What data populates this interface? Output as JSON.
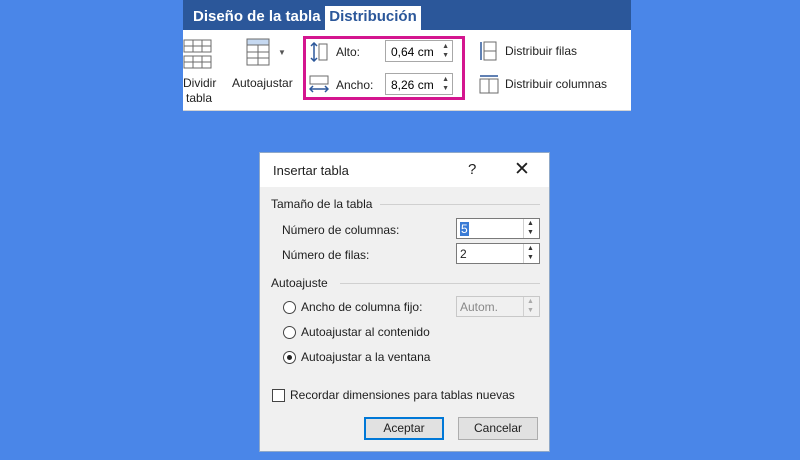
{
  "ribbon": {
    "tabs": [
      "Diseño de la tabla",
      "Distribución"
    ],
    "active_tab": "Distribución",
    "split_table": {
      "line1": "Dividir",
      "line2": "tabla"
    },
    "autofit": "Autoajustar",
    "height": {
      "label": "Alto:",
      "value": "0,64 cm"
    },
    "width": {
      "label": "Ancho:",
      "value": "8,26 cm"
    },
    "distribute_rows": "Distribuir filas",
    "distribute_columns": "Distribuir columnas",
    "highlight_color": "#d4158f"
  },
  "dialog": {
    "title": "Insertar tabla",
    "help": "?",
    "close": "✕",
    "size_group": "Tamaño de la tabla",
    "columns_label": "Número de columnas:",
    "columns_value": "5",
    "rows_label": "Número de filas:",
    "rows_value": "2",
    "autofit_group": "Autoajuste",
    "opt_fixed": "Ancho de columna fijo:",
    "fixed_value": "Autom.",
    "opt_content": "Autoajustar al contenido",
    "opt_window": "Autoajustar a la ventana",
    "selected_option": "Autoajustar a la ventana",
    "remember": "Recordar dimensiones para tablas nuevas",
    "remember_checked": false,
    "ok": "Aceptar",
    "cancel": "Cancelar"
  },
  "colors": {
    "background": "#4a86e8",
    "ribbon_tabbar": "#2b579a"
  }
}
